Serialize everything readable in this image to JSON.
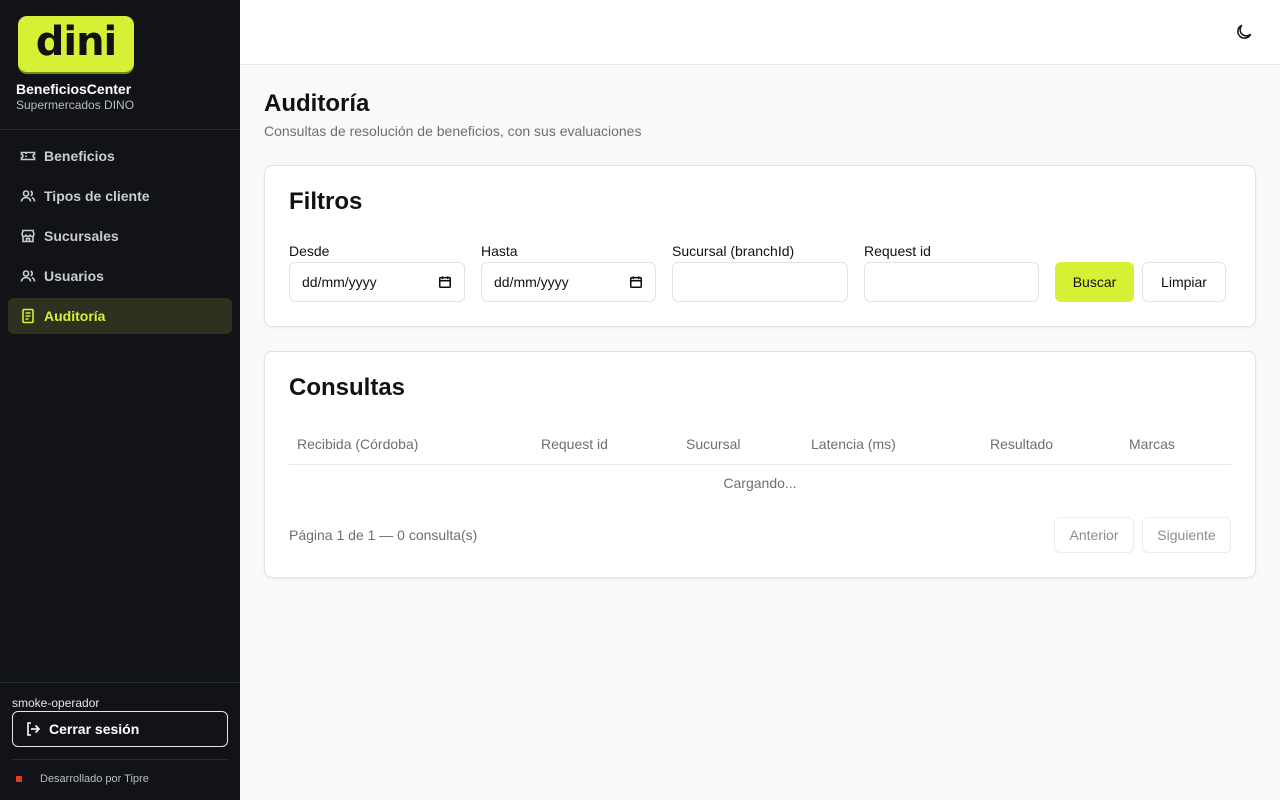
{
  "sidebar": {
    "logo_text": "dini",
    "brand_title": "BeneficiosCenter",
    "brand_subtitle": "Supermercados DINO",
    "nav": [
      {
        "label": "Beneficios",
        "icon": "ticket-icon"
      },
      {
        "label": "Tipos de cliente",
        "icon": "users-icon"
      },
      {
        "label": "Sucursales",
        "icon": "store-icon"
      },
      {
        "label": "Usuarios",
        "icon": "users-icon"
      },
      {
        "label": "Auditoría",
        "icon": "document-icon",
        "active": true
      }
    ],
    "user": "smoke-operador",
    "logout_label": "Cerrar sesión",
    "footer": "Desarrollado por Tipre"
  },
  "header": {
    "theme_icon": "moon-icon"
  },
  "page": {
    "title": "Auditoría",
    "subtitle": "Consultas de resolución de beneficios, con sus evaluaciones"
  },
  "filters": {
    "title": "Filtros",
    "desde_label": "Desde",
    "desde_value": "dd/mm/yyyy",
    "hasta_label": "Hasta",
    "hasta_value": "dd/mm/yyyy",
    "sucursal_label": "Sucursal (branchId)",
    "sucursal_value": "",
    "request_label": "Request id",
    "request_value": "",
    "search_label": "Buscar",
    "clear_label": "Limpiar"
  },
  "results": {
    "title": "Consultas",
    "columns": [
      "Recibida (Córdoba)",
      "Request id",
      "Sucursal",
      "Latencia (ms)",
      "Resultado",
      "Marcas"
    ],
    "loading_text": "Cargando...",
    "pager_info": "Página 1 de 1 — 0 consulta(s)",
    "prev_label": "Anterior",
    "next_label": "Siguiente"
  },
  "colors": {
    "accent": "#d6f135",
    "sidebar_bg": "#111317",
    "active_nav_bg": "#2d311f"
  }
}
